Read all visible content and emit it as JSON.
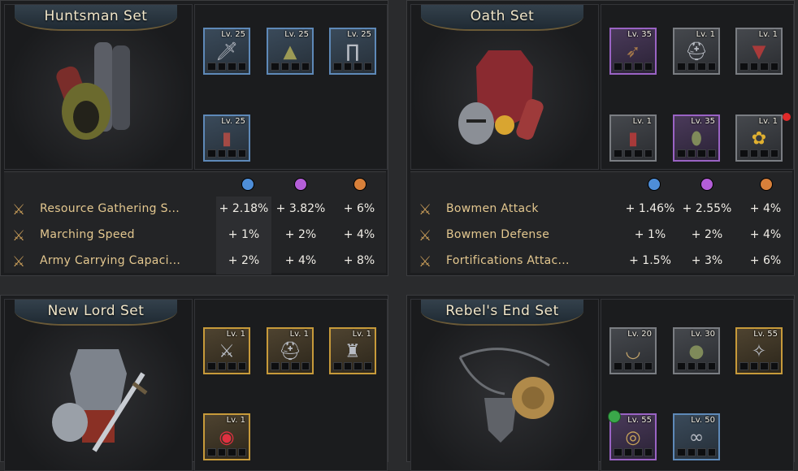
{
  "sets": [
    {
      "title": "Huntsman Set",
      "items": [
        {
          "level": "Lv. 25",
          "rarity": "blue",
          "icon": "knife-icon"
        },
        {
          "level": "Lv. 25",
          "rarity": "blue",
          "icon": "hood-icon"
        },
        {
          "level": "Lv. 25",
          "rarity": "blue",
          "icon": "pants-icon"
        },
        {
          "level": "Lv. 25",
          "rarity": "blue",
          "icon": "bracer-icon"
        }
      ],
      "stats": [
        {
          "name": "Resource Gathering S...",
          "values": [
            "+ 2.18%",
            "+ 3.82%",
            "+ 6%"
          ]
        },
        {
          "name": "Marching Speed",
          "values": [
            "+ 1%",
            "+ 2%",
            "+ 4%"
          ]
        },
        {
          "name": "Army Carrying Capaci...",
          "values": [
            "+ 2%",
            "+ 4%",
            "+ 8%"
          ]
        }
      ]
    },
    {
      "title": "Oath Set",
      "items": [
        {
          "level": "Lv. 35",
          "rarity": "purple",
          "icon": "crossbow-icon"
        },
        {
          "level": "Lv. 1",
          "rarity": "gray",
          "icon": "helmet-icon"
        },
        {
          "level": "Lv. 1",
          "rarity": "gray",
          "icon": "chestplate-icon"
        },
        {
          "level": "Lv. 1",
          "rarity": "gray",
          "icon": "bracer-icon"
        },
        {
          "level": "Lv. 35",
          "rarity": "purple",
          "icon": "shield-icon"
        },
        {
          "level": "Lv. 1",
          "rarity": "gray",
          "icon": "flower-icon"
        }
      ],
      "stats": [
        {
          "name": "Bowmen Attack",
          "values": [
            "+ 1.46%",
            "+ 2.55%",
            "+ 4%"
          ]
        },
        {
          "name": "Bowmen Defense",
          "values": [
            "+ 1%",
            "+ 2%",
            "+ 4%"
          ]
        },
        {
          "name": "Fortifications Attac...",
          "values": [
            "+ 1.5%",
            "+ 3%",
            "+ 6%"
          ]
        }
      ]
    },
    {
      "title": "New Lord Set",
      "items": [
        {
          "level": "Lv. 1",
          "rarity": "gold",
          "icon": "sword-icon"
        },
        {
          "level": "Lv. 1",
          "rarity": "gold",
          "icon": "helmet-icon"
        },
        {
          "level": "Lv. 1",
          "rarity": "gold",
          "icon": "armor-icon"
        },
        {
          "level": "Lv. 1",
          "rarity": "gold",
          "icon": "ring-icon"
        }
      ]
    },
    {
      "title": "Rebel's End Set",
      "items": [
        {
          "level": "Lv. 20",
          "rarity": "gray",
          "icon": "necklace-icon"
        },
        {
          "level": "Lv. 30",
          "rarity": "gray",
          "icon": "pouch-icon"
        },
        {
          "level": "Lv. 55",
          "rarity": "gold",
          "icon": "claw-icon"
        },
        {
          "level": "Lv. 55",
          "rarity": "purple",
          "icon": "medallion-icon"
        },
        {
          "level": "Lv. 50",
          "rarity": "blue",
          "icon": "chain-icon"
        }
      ]
    }
  ],
  "tier_colors": [
    "#4e8ed8",
    "#b45ed8",
    "#d8803a"
  ]
}
